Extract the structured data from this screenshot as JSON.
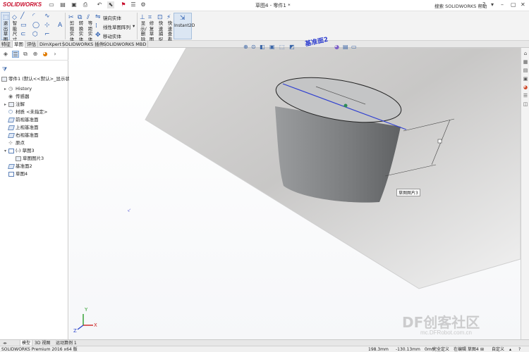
{
  "app": {
    "logo": "SOLIDWORKS",
    "window_title": "草图4 - 零件1 *",
    "help_search": "搜索 SOLIDWORKS 帮助"
  },
  "ribbon": {
    "exit_sketch": "退出草图",
    "smart_dim": "智能尺寸",
    "trim": "剪裁实体",
    "convert": "转换实体引用",
    "offset": "等距实体",
    "mirror": "镜向实体",
    "linear_pattern": "线性草图阵列",
    "move": "移动实体",
    "display_delete": "显示/删除",
    "repair": "修复草图",
    "quick_snap": "快速捕捉",
    "quick_view": "快速查看",
    "instant2d": "Instant2D"
  },
  "tabs": [
    "特征",
    "草图",
    "评估",
    "DimXpert",
    "SOLIDWORKS 插件",
    "SOLIDWORKS MBD"
  ],
  "tree": {
    "root": "零件1 (默认<<默认>_显示状态",
    "items": [
      {
        "label": "History",
        "icon": "history-icon",
        "arrow": "▸"
      },
      {
        "label": "传感器",
        "icon": "sensor-icon",
        "arrow": ""
      },
      {
        "label": "注解",
        "icon": "annotation-icon",
        "arrow": "▸"
      },
      {
        "label": "材质 <未指定>",
        "icon": "material-icon",
        "arrow": ""
      },
      {
        "label": "前视基准面",
        "icon": "plane-icon",
        "arrow": ""
      },
      {
        "label": "上视基准面",
        "icon": "plane-icon",
        "arrow": ""
      },
      {
        "label": "右视基准面",
        "icon": "plane-icon",
        "arrow": ""
      },
      {
        "label": "原点",
        "icon": "origin-icon",
        "arrow": ""
      },
      {
        "label": "(-) 草图3",
        "icon": "sketch-icon",
        "arrow": "▾"
      },
      {
        "label": "草图图片3",
        "icon": "picture-icon",
        "arrow": ""
      },
      {
        "label": "基准面2",
        "icon": "plane-icon",
        "arrow": ""
      },
      {
        "label": "草图4",
        "icon": "sketch-icon",
        "arrow": ""
      }
    ]
  },
  "viewport": {
    "plane_label": "基准面2",
    "picture_label": "草图图片3",
    "triad": {
      "x": "X",
      "y": "Y",
      "z": "Z"
    }
  },
  "bottom_tabs": [
    "模型",
    "3D 视图",
    "运动算例 1"
  ],
  "status": {
    "product": "SOLIDWORKS Premium 2016 x64 版",
    "x": "198.3mm",
    "y": "-130.13mm",
    "z": "0mm",
    "defined": "完全定义",
    "editing": "在编辑 草图4",
    "custom": "自定义"
  },
  "watermark": {
    "main": "DF创客社区",
    "url": "mc.DFRobot.com.cn"
  },
  "colors": {
    "accent": "#3b66a8",
    "logo": "#c8102e",
    "sketch_blue": "#2f3fd0",
    "ellipse": "#222222"
  }
}
